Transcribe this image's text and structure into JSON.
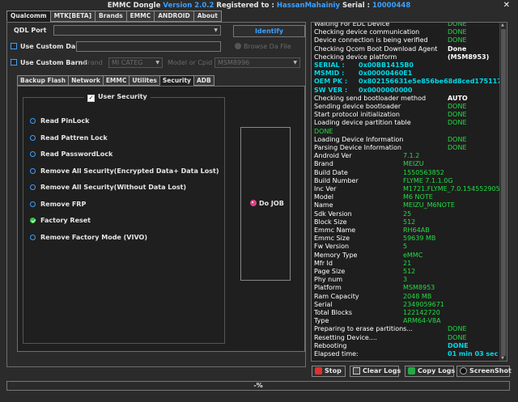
{
  "window": {
    "title_prefix": "EMMC Dongle",
    "version": "Version 2.0.2",
    "registered_label": "Registered to :",
    "user": "HassanMahainiy",
    "serial_label": "Serial :",
    "serial": "10000448",
    "close_glyph": "✕"
  },
  "top_tabs": [
    {
      "label": "Qualcomm",
      "active": true
    },
    {
      "label": "MTK[BETA]",
      "active": false
    },
    {
      "label": "Brands",
      "active": false
    },
    {
      "label": "EMMC",
      "active": false
    },
    {
      "label": "ANDROID",
      "active": false
    },
    {
      "label": "About",
      "active": false
    }
  ],
  "qdl": {
    "port_label": "QDL Port",
    "port_value": "",
    "identify_label": "Identify",
    "custom_da_label": "Use Custom Da",
    "custom_da_checked": false,
    "browse_label": "Browse Da File",
    "custom_brand_label": "Use Custom Barnd",
    "custom_brand_checked": false,
    "brand_label": "Brand",
    "brand_value": "MI CATEG",
    "model_label": "Model or Cpid",
    "model_value": "MSM8996"
  },
  "inner_tabs": [
    {
      "label": "Backup  Flash",
      "active": false
    },
    {
      "label": "Network",
      "active": false
    },
    {
      "label": "EMMC",
      "active": false
    },
    {
      "label": "Utilites",
      "active": false
    },
    {
      "label": "Security",
      "active": true
    },
    {
      "label": "ADB",
      "active": false
    }
  ],
  "security": {
    "group_label": "User Security",
    "group_checked": true,
    "options": [
      {
        "label": "Read PinLock",
        "checked": false
      },
      {
        "label": "Read Pattren Lock",
        "checked": false
      },
      {
        "label": "Read PasswordLock",
        "checked": false
      },
      {
        "label": "Remove All Security(Encrypted Data+ Data Lost)",
        "checked": false
      },
      {
        "label": "Remove All Security(Without Data Lost)",
        "checked": false
      },
      {
        "label": "Remove FRP",
        "checked": false
      },
      {
        "label": "Factory Reset",
        "checked": true
      },
      {
        "label": "Remove Factory Mode (VIVO)",
        "checked": false
      }
    ],
    "do_job_label": "Do JOB"
  },
  "log": [
    {
      "label": "Waiting For EDL Device",
      "value": "DONE",
      "lc": "white",
      "vc": "green",
      "vx": 165
    },
    {
      "label": "Checking device communication",
      "value": "DONE",
      "lc": "white",
      "vc": "green",
      "vx": 165
    },
    {
      "label": "Device connection is being verified",
      "value": "DONE",
      "lc": "white",
      "vc": "green",
      "vx": 165
    },
    {
      "label": "Checking Qcom Boot Download Agent",
      "value": "Done",
      "lc": "white",
      "vc": "white",
      "vx": 165
    },
    {
      "label": "Checking device platform",
      "value": "(MSM8953)",
      "lc": "white",
      "vc": "white",
      "vx": 165
    },
    {
      "label": "SERIAL :",
      "value": "0x00BB1415B0",
      "lc": "cyan",
      "vc": "cyan",
      "vx": 55
    },
    {
      "label": "MSMID  :",
      "value": "0x00000460E1",
      "lc": "cyan",
      "vc": "cyan",
      "vx": 55
    },
    {
      "label": "OEM PK :",
      "value": "0x802156631e5e856be68d8ced1751174d",
      "lc": "cyan",
      "vc": "cyan",
      "vx": 55
    },
    {
      "label": "SW VER :",
      "value": "0x0000000000",
      "lc": "cyan",
      "vc": "cyan",
      "vx": 55
    },
    {
      "label": "Checking send bootloader method",
      "value": "AUTO",
      "lc": "white",
      "vc": "white",
      "vx": 165
    },
    {
      "label": "Sending device bootloader",
      "value": "DONE",
      "lc": "white",
      "vc": "green",
      "vx": 165
    },
    {
      "label": "Start protocol initialization",
      "value": "DONE",
      "lc": "white",
      "vc": "green",
      "vx": 165
    },
    {
      "label": "Loading device partition table",
      "value": "DONE",
      "lc": "white",
      "vc": "green",
      "vx": 165
    },
    {
      "label": "DONE",
      "value": "",
      "lc": "green",
      "vc": "green",
      "vx": 165
    },
    {
      "label": "Loading Device Information",
      "value": "DONE",
      "lc": "white",
      "vc": "green",
      "vx": 165
    },
    {
      "label": "Parsing Device Information",
      "value": "DONE",
      "lc": "white",
      "vc": "green",
      "vx": 165
    },
    {
      "label": "Android Ver",
      "value": "7.1.2",
      "lc": "white",
      "vc": "green",
      "vx": 110
    },
    {
      "label": "Brand",
      "value": "MEIZU",
      "lc": "white",
      "vc": "green",
      "vx": 110
    },
    {
      "label": "Build Date",
      "value": "1550563852",
      "lc": "white",
      "vc": "green",
      "vx": 110
    },
    {
      "label": "Build Number",
      "value": "FLYME 7.1.1.0G",
      "lc": "white",
      "vc": "green",
      "vx": 110
    },
    {
      "label": "Inc Ver",
      "value": "M1721.FLYME_7.0.1545529059",
      "lc": "white",
      "vc": "green",
      "vx": 110
    },
    {
      "label": "Model",
      "value": "M6 NOTE",
      "lc": "white",
      "vc": "green",
      "vx": 110
    },
    {
      "label": "Name",
      "value": "MEIZU_M6NOTE",
      "lc": "white",
      "vc": "green",
      "vx": 110
    },
    {
      "label": "Sdk Version",
      "value": "25",
      "lc": "white",
      "vc": "green",
      "vx": 110
    },
    {
      "label": "Block Size",
      "value": "512",
      "lc": "white",
      "vc": "green",
      "vx": 110
    },
    {
      "label": "Emmc Name",
      "value": "RH64AB",
      "lc": "white",
      "vc": "green",
      "vx": 110
    },
    {
      "label": "Emmc Size",
      "value": "59639 MB",
      "lc": "white",
      "vc": "green",
      "vx": 110
    },
    {
      "label": "Fw Version",
      "value": "5",
      "lc": "white",
      "vc": "green",
      "vx": 110
    },
    {
      "label": "Memory Type",
      "value": "eMMC",
      "lc": "white",
      "vc": "green",
      "vx": 110
    },
    {
      "label": "Mfr Id",
      "value": "21",
      "lc": "white",
      "vc": "green",
      "vx": 110
    },
    {
      "label": "Page Size",
      "value": "512",
      "lc": "white",
      "vc": "green",
      "vx": 110
    },
    {
      "label": "Phy num",
      "value": "3",
      "lc": "white",
      "vc": "green",
      "vx": 110
    },
    {
      "label": "Platform",
      "value": "MSM8953",
      "lc": "white",
      "vc": "green",
      "vx": 110
    },
    {
      "label": "Ram Capacity",
      "value": "2048 MB",
      "lc": "white",
      "vc": "green",
      "vx": 110
    },
    {
      "label": "Serial",
      "value": "2349059671",
      "lc": "white",
      "vc": "green",
      "vx": 110
    },
    {
      "label": "Total Blocks",
      "value": "122142720",
      "lc": "white",
      "vc": "green",
      "vx": 110
    },
    {
      "label": "Type",
      "value": "ARM64-V8A",
      "lc": "white",
      "vc": "green",
      "vx": 110
    },
    {
      "label": "Preparing to erase partitions...",
      "value": "DONE",
      "lc": "white",
      "vc": "green",
      "vx": 165
    },
    {
      "label": "Resetting Device....",
      "value": "DONE",
      "lc": "white",
      "vc": "green",
      "vx": 165
    },
    {
      "label": "Rebooting",
      "value": "DONE",
      "lc": "white",
      "vc": "cyan",
      "vx": 165
    },
    {
      "label": "Elapsed time:",
      "value": "01 min  03 sec",
      "lc": "white",
      "vc": "cyan",
      "vx": 165
    }
  ],
  "buttons": {
    "stop": "Stop",
    "clear_logs": "Clear Logs",
    "copy_logs": "Copy Logs",
    "screenshot": "ScreenShot"
  },
  "progress": {
    "text": "-%",
    "fraction": 0
  },
  "colors": {
    "accent": "#3aa0ff",
    "green": "#22dd44",
    "cyan": "#00d8e8",
    "white": "#ffffff"
  }
}
